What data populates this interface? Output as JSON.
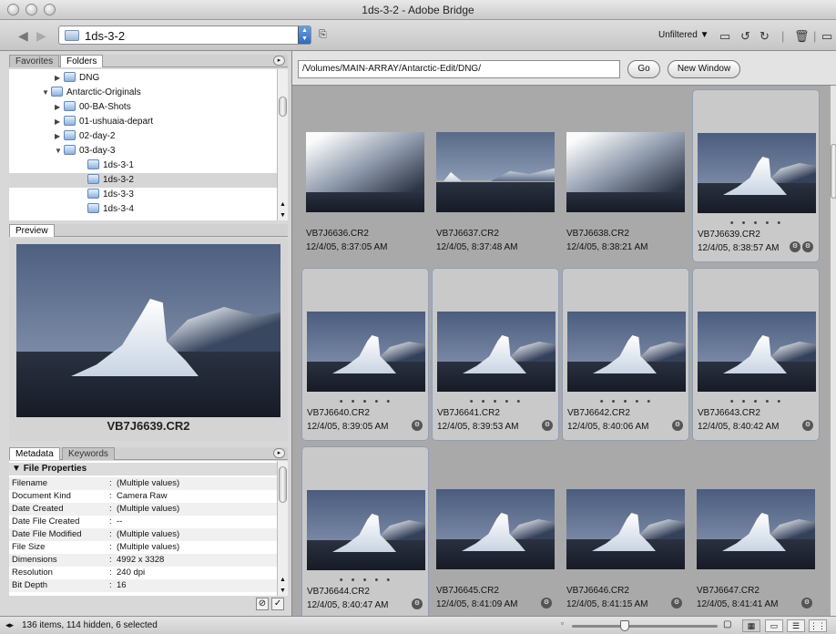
{
  "window": {
    "title": "1ds-3-2 - Adobe Bridge"
  },
  "toolbar": {
    "back_icon": "back-arrow-icon",
    "forward_icon": "forward-arrow-icon",
    "location": "1ds-3-2",
    "filter_label": "Unfiltered ▼",
    "icons": [
      "new-folder-icon",
      "rotate-left-icon",
      "rotate-right-icon",
      "trash-icon",
      "compact-mode-icon"
    ]
  },
  "folders_panel": {
    "tabs": [
      "Favorites",
      "Folders"
    ],
    "active_tab": "Folders",
    "tree": [
      {
        "label": "DNG",
        "expanded": false,
        "selected": false,
        "level": 2
      },
      {
        "label": "Antarctic-Originals",
        "expanded": true,
        "selected": false,
        "level": 1
      },
      {
        "label": "00-BA-Shots",
        "expanded": false,
        "selected": false,
        "level": 2
      },
      {
        "label": "01-ushuaia-depart",
        "expanded": false,
        "selected": false,
        "level": 2
      },
      {
        "label": "02-day-2",
        "expanded": false,
        "selected": false,
        "level": 2
      },
      {
        "label": "03-day-3",
        "expanded": true,
        "selected": false,
        "level": 2
      },
      {
        "label": "1ds-3-1",
        "expanded": null,
        "selected": false,
        "level": 3
      },
      {
        "label": "1ds-3-2",
        "expanded": null,
        "selected": true,
        "level": 3
      },
      {
        "label": "1ds-3-3",
        "expanded": null,
        "selected": false,
        "level": 3
      },
      {
        "label": "1ds-3-4",
        "expanded": null,
        "selected": false,
        "level": 3
      }
    ]
  },
  "preview_panel": {
    "tab": "Preview",
    "filename": "VB7J6639.CR2"
  },
  "metadata_panel": {
    "tabs": [
      "Metadata",
      "Keywords"
    ],
    "section": "File Properties",
    "rows": [
      {
        "k": "Filename",
        "v": "(Multiple values)"
      },
      {
        "k": "Document Kind",
        "v": "Camera Raw"
      },
      {
        "k": "Date Created",
        "v": "(Multiple values)"
      },
      {
        "k": "Date File Created",
        "v": "--"
      },
      {
        "k": "Date File Modified",
        "v": "(Multiple values)"
      },
      {
        "k": "File Size",
        "v": "(Multiple values)"
      },
      {
        "k": "Dimensions",
        "v": "4992 x 3328"
      },
      {
        "k": "Resolution",
        "v": "240 dpi"
      },
      {
        "k": "Bit Depth",
        "v": "16"
      }
    ]
  },
  "content": {
    "path": "/Volumes/MAIN-ARRAY/Antarctic-Edit/DNG/",
    "go_label": "Go",
    "new_window_label": "New Window",
    "thumbs": [
      {
        "name": "VB7J6636.CR2",
        "date": "12/4/05, 8:37:05 AM",
        "selected": false,
        "rated": false,
        "badge": false,
        "scene": "mountain"
      },
      {
        "name": "VB7J6637.CR2",
        "date": "12/4/05, 8:37:48 AM",
        "selected": false,
        "rated": false,
        "badge": false,
        "scene": "far"
      },
      {
        "name": "VB7J6638.CR2",
        "date": "12/4/05, 8:38:21 AM",
        "selected": false,
        "rated": false,
        "badge": false,
        "scene": "mountain"
      },
      {
        "name": "VB7J6639.CR2",
        "date": "12/4/05, 8:38:57 AM",
        "selected": true,
        "rated": true,
        "badge": true,
        "scene": "berg"
      },
      {
        "name": "VB7J6640.CR2",
        "date": "12/4/05, 8:39:05 AM",
        "selected": true,
        "rated": true,
        "badge": true,
        "scene": "berg"
      },
      {
        "name": "VB7J6641.CR2",
        "date": "12/4/05, 8:39:53 AM",
        "selected": true,
        "rated": true,
        "badge": true,
        "scene": "berg"
      },
      {
        "name": "VB7J6642.CR2",
        "date": "12/4/05, 8:40:06 AM",
        "selected": true,
        "rated": true,
        "badge": true,
        "scene": "berg"
      },
      {
        "name": "VB7J6643.CR2",
        "date": "12/4/05, 8:40:42 AM",
        "selected": true,
        "rated": true,
        "badge": true,
        "scene": "berg"
      },
      {
        "name": "VB7J6644.CR2",
        "date": "12/4/05, 8:40:47 AM",
        "selected": true,
        "rated": true,
        "badge": true,
        "scene": "berg"
      },
      {
        "name": "VB7J6645.CR2",
        "date": "12/4/05, 8:41:09 AM",
        "selected": false,
        "rated": false,
        "badge": true,
        "scene": "berg"
      },
      {
        "name": "VB7J6646.CR2",
        "date": "12/4/05, 8:41:15 AM",
        "selected": false,
        "rated": false,
        "badge": true,
        "scene": "berg"
      },
      {
        "name": "VB7J6647.CR2",
        "date": "12/4/05, 8:41:41 AM",
        "selected": false,
        "rated": false,
        "badge": true,
        "scene": "berg"
      }
    ]
  },
  "status": {
    "text": "136 items, 114 hidden, 6 selected",
    "thumb_size_fraction": 0.35
  }
}
